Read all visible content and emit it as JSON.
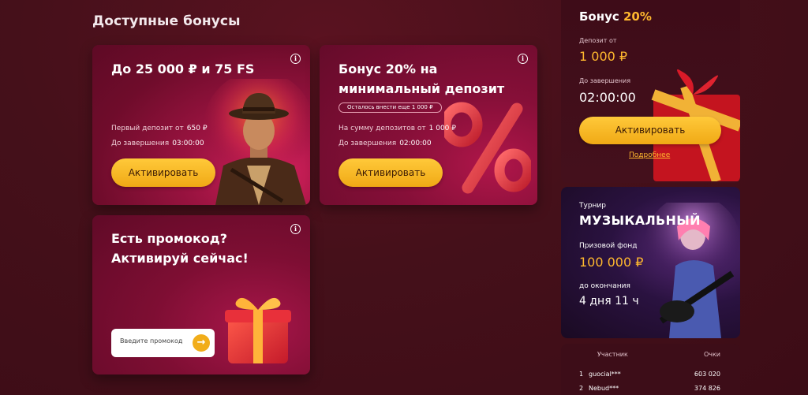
{
  "section_title": "Доступные бонусы",
  "cards": {
    "deposit_bonus": {
      "title_line1": "До 25 000 ₽ и 75 FS",
      "first_deposit_label": "Первый депозит от",
      "first_deposit_value": "650 ₽",
      "until_end_label": "До завершения",
      "until_end_value": "03:00:00",
      "button": "Активировать",
      "info": "i"
    },
    "min_deposit_bonus": {
      "title_line1": "Бонус 20% на",
      "title_line2": "минимальный депозит",
      "remaining": "Осталось внести еще 1 000 ₽",
      "sum_label": "На сумму депозитов от",
      "sum_value": "1 000 ₽",
      "until_end_label": "До завершения",
      "until_end_value": "02:00:00",
      "button": "Активировать",
      "info": "i"
    },
    "promo": {
      "title_line1": "Есть промокод?",
      "title_line2": "Активируй сейчас!",
      "placeholder": "Введите промокод",
      "go": "→",
      "info": "i"
    }
  },
  "side_bonus": {
    "title_prefix": "Бонус ",
    "title_accent": "20%",
    "deposit_label": "Депозит от",
    "deposit_value": "1 000 ₽",
    "until_label": "До завершения",
    "until_value": "02:00:00",
    "button": "Активировать",
    "details_link": "Подробнее"
  },
  "tournament": {
    "label": "Турнир",
    "name": "МУЗЫКАЛЬНЫЙ",
    "prize_label": "Призовой фонд",
    "prize_value": "100 000 ₽",
    "ends_label": "до окончания",
    "ends_value": "4 дня  11 ч"
  },
  "leaderboard": {
    "col_participant": "Участник",
    "col_points": "Очки",
    "rows": [
      {
        "rank": "1",
        "name": "guocial***",
        "points": "603 020"
      },
      {
        "rank": "2",
        "name": "Nebud***",
        "points": "374 826"
      }
    ]
  },
  "colors": {
    "accent_gold": "#ffb82e",
    "button_gold": "#f0a915",
    "bg": "#45101a"
  },
  "icons": [
    "info-icon",
    "arrow-right-icon",
    "gift-icon",
    "percent-icon"
  ]
}
